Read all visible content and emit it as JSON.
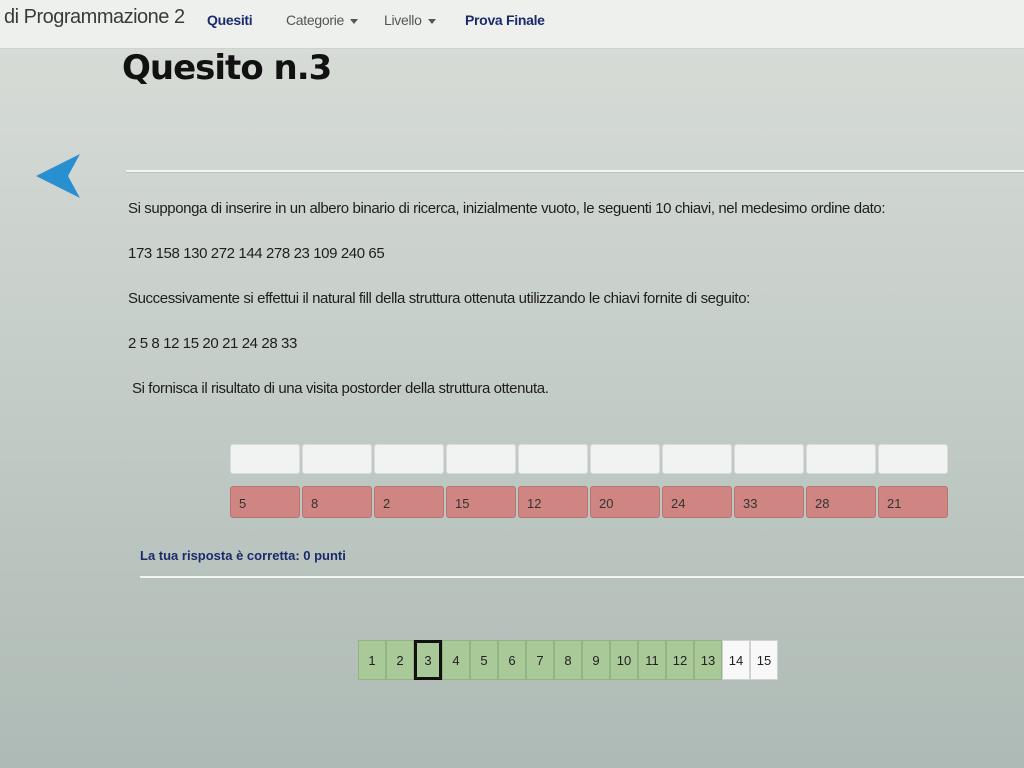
{
  "nav": {
    "brand": "di Programmazione 2",
    "items": [
      {
        "label": "Quesiti",
        "bold": true,
        "caret": false
      },
      {
        "label": "Categorie",
        "bold": false,
        "caret": true
      },
      {
        "label": "Livello",
        "bold": false,
        "caret": true
      },
      {
        "label": "Prova Finale",
        "bold": true,
        "caret": false
      }
    ]
  },
  "question": {
    "title": "Quesito n.3",
    "lines": [
      "Si supponga di inserire in un albero binario di ricerca, inizialmente vuoto, le seguenti 10 chiavi, nel medesimo ordine dato:",
      "173 158 130 272 144 278 23 109 240 65",
      "Successivamente si effettui il natural fill della struttura ottenuta utilizzando le chiavi fornite di seguito:",
      "2 5 8 12 15 20 21 24 28 33",
      "Si fornisca il risultato di una visita postorder della struttura ottenuta."
    ]
  },
  "answer": {
    "slot_count": 10,
    "keys": [
      "5",
      "8",
      "2",
      "15",
      "12",
      "20",
      "24",
      "33",
      "28",
      "21"
    ]
  },
  "result_text": "La tua risposta è corretta: 0 punti",
  "pagination": {
    "pages": [
      "1",
      "2",
      "3",
      "4",
      "5",
      "6",
      "7",
      "8",
      "9",
      "10",
      "11",
      "12",
      "13",
      "14",
      "15"
    ],
    "current": "3",
    "unvisited": [
      "14",
      "15"
    ]
  },
  "colors": {
    "key_tile": "#cf8682",
    "page_done": "#a9c998",
    "nav_accent": "#1b2a6b",
    "back_arrow": "#2a8fd0"
  },
  "icons": {
    "back": "left-arrow-icon",
    "dropdown": "caret-down-icon"
  }
}
